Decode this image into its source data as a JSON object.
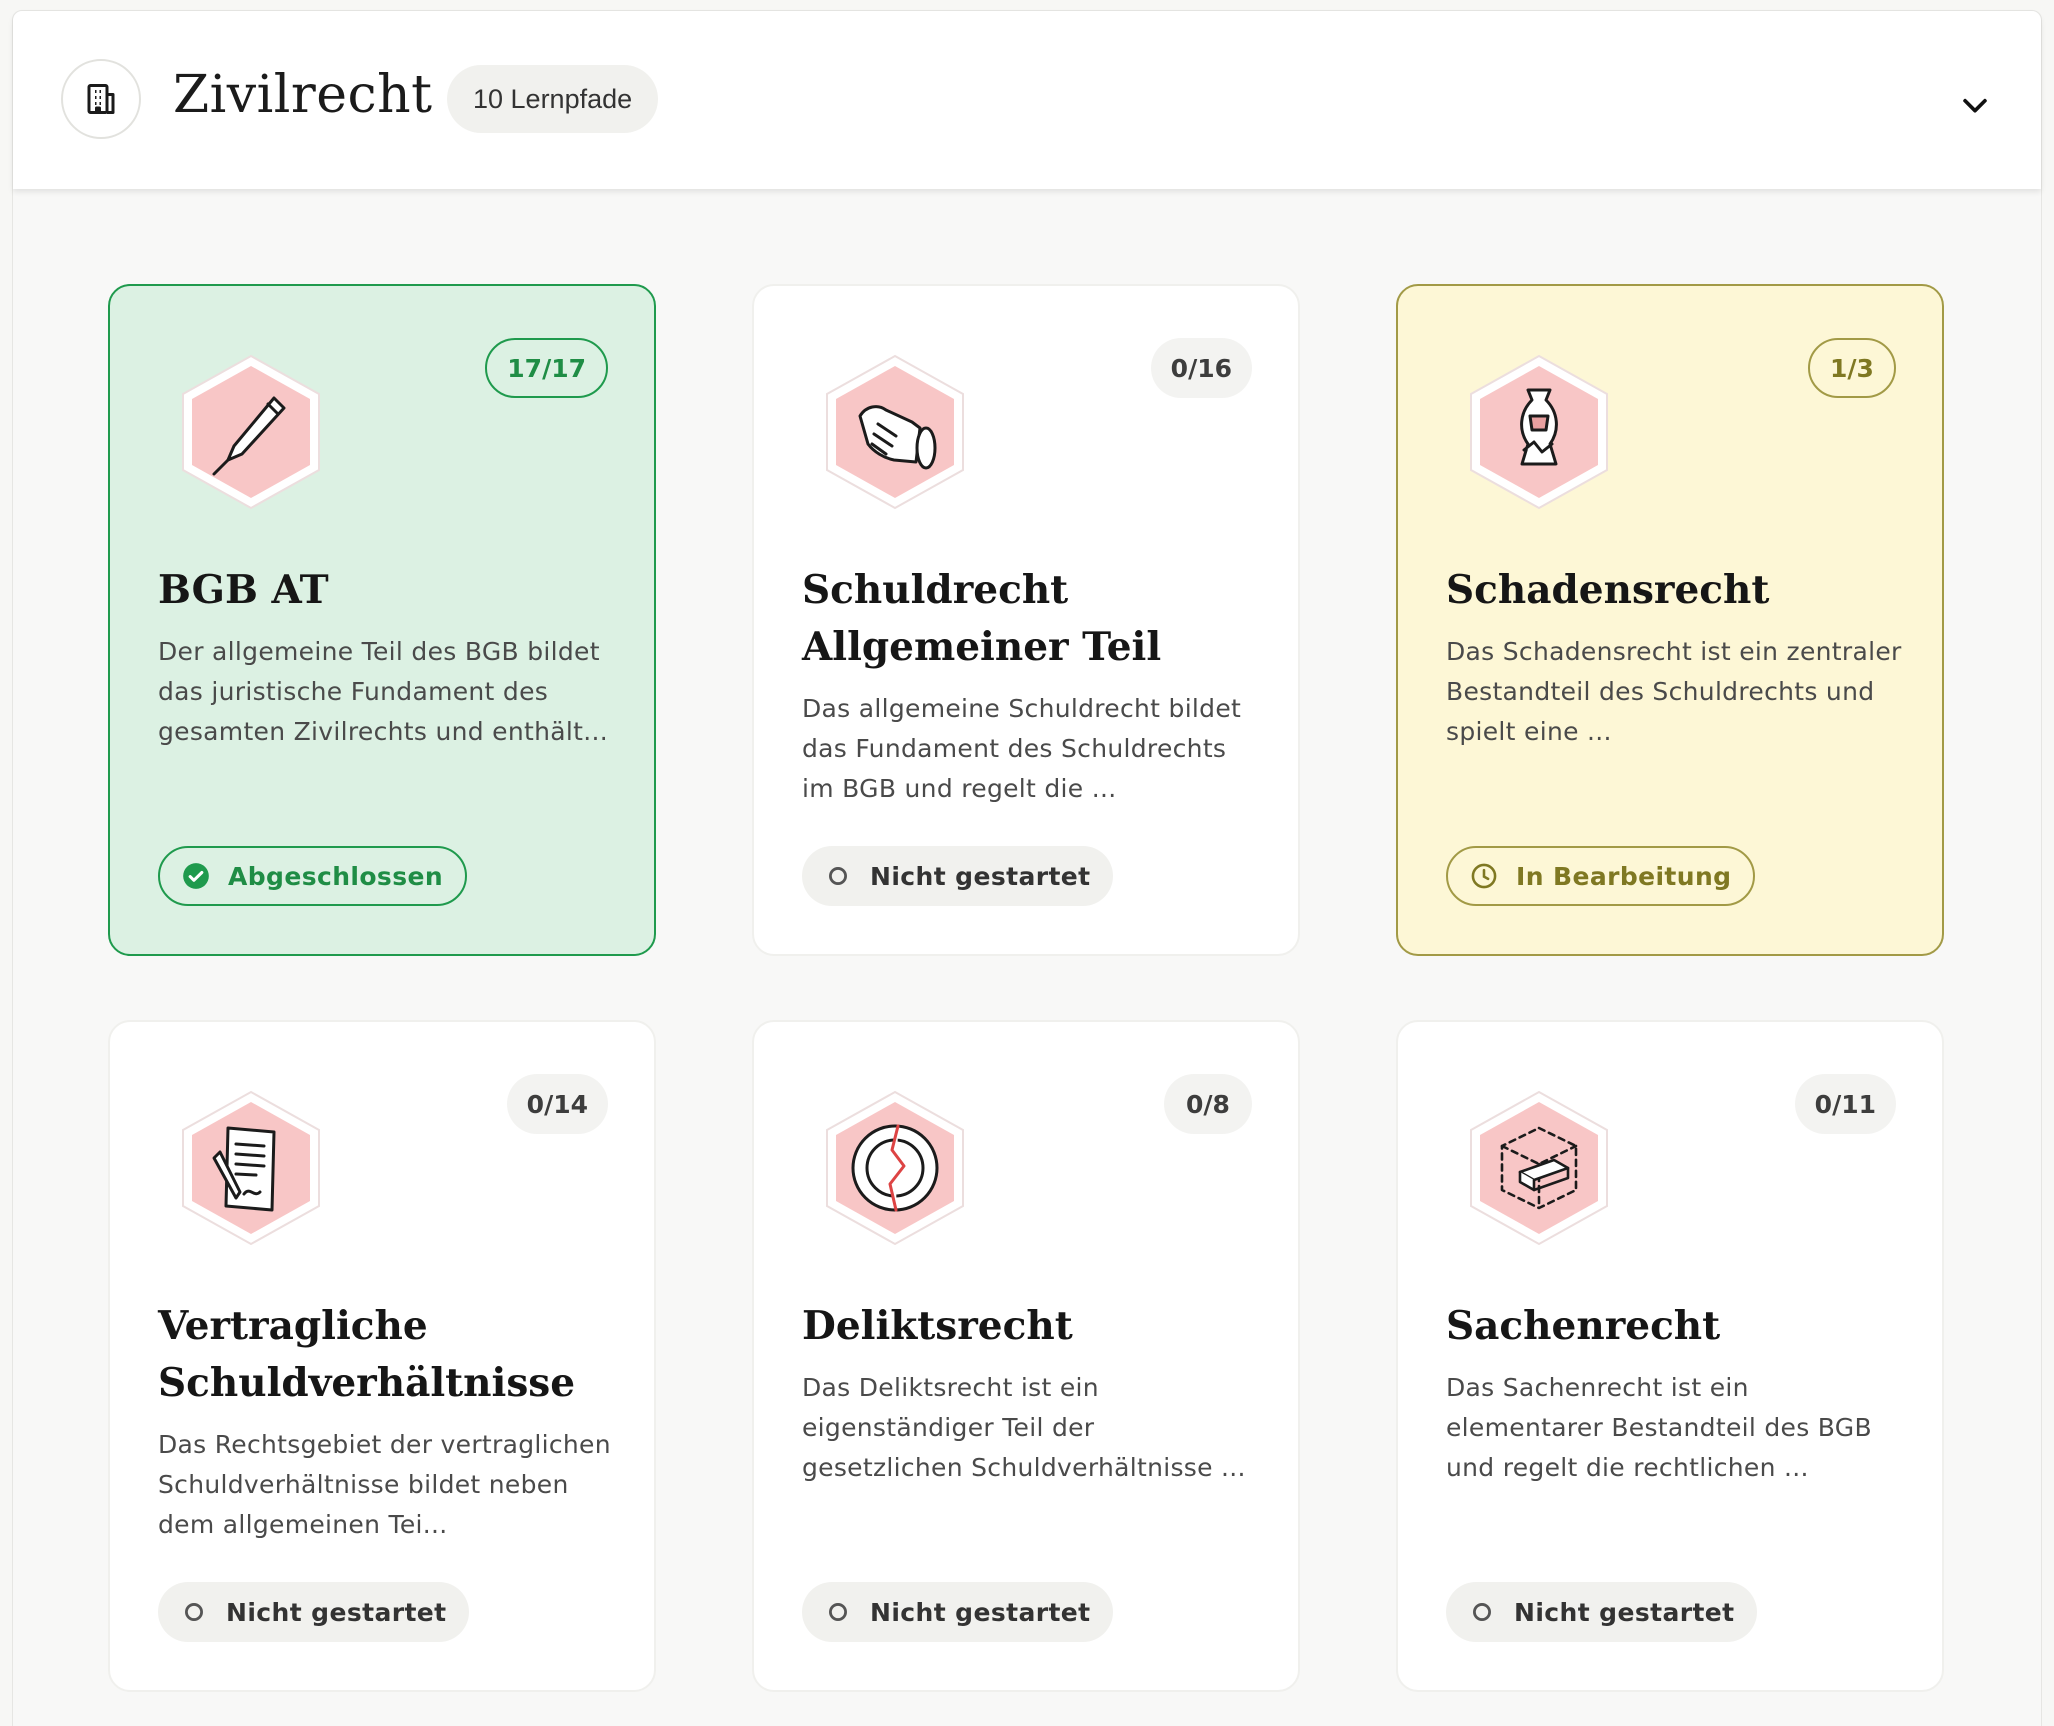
{
  "header": {
    "title": "Zivilrecht",
    "badge": "10 Lernpfade",
    "icon": "building-icon",
    "toggle_icon": "chevron-down-icon"
  },
  "colors": {
    "done_bg": "#dcf1e3",
    "done_accent": "#1f9a4d",
    "progress_bg": "#fdf7d6",
    "progress_accent": "#a29a46",
    "hex_fill": "#f8c6c6"
  },
  "cards": [
    {
      "title": "BGB AT",
      "count": "17/17",
      "description": "Der allgemeine Teil des BGB bildet das juristische Fundament des gesamten Zivilrechts und enthält...",
      "status": "Abgeschlossen",
      "state": "done",
      "icon": "pen-icon"
    },
    {
      "title": "Schuldrecht Allgemeiner Teil",
      "count": "0/16",
      "description": "Das allgemeine Schuldrecht bildet das Fundament des Schuldrechts im BGB und regelt die ...",
      "status": "Nicht gestartet",
      "state": "new",
      "icon": "handshake-icon"
    },
    {
      "title": "Schadensrecht",
      "count": "1/3",
      "description": "Das Schadensrecht ist ein zentraler Bestandteil des Schuldrechts und spielt eine ...",
      "status": "In Bearbeitung",
      "state": "progress",
      "icon": "broken-vase-icon"
    },
    {
      "title": "Vertragliche Schuldverhältnisse",
      "count": "0/14",
      "description": "Das Rechtsgebiet der vertraglichen Schuldverhältnisse bildet neben dem allgemeinen Tei...",
      "status": "Nicht gestartet",
      "state": "new",
      "icon": "contract-icon"
    },
    {
      "title": "Deliktsrecht",
      "count": "0/8",
      "description": "Das Deliktsrecht ist ein eigenständiger Teil der gesetzlichen Schuldverhältnisse ...",
      "status": "Nicht gestartet",
      "state": "new",
      "icon": "broken-plate-icon"
    },
    {
      "title": "Sachenrecht",
      "count": "0/11",
      "description": "Das Sachenrecht ist ein elementarer Bestandteil des BGB und regelt die rechtlichen ...",
      "status": "Nicht gestartet",
      "state": "new",
      "icon": "object-box-icon"
    }
  ]
}
